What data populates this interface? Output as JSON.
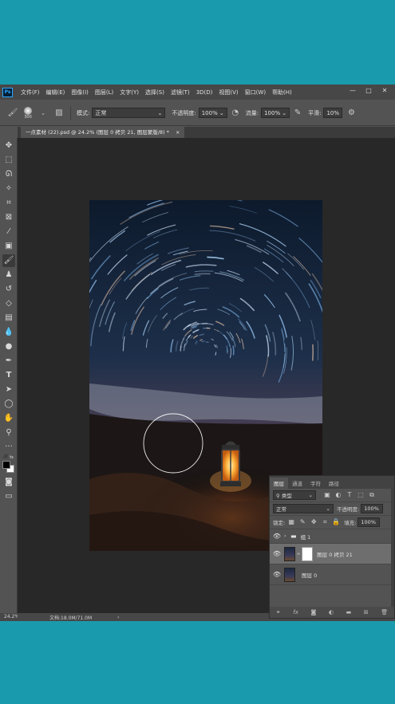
{
  "menubar": {
    "logo": "Ps",
    "items": [
      "文件(F)",
      "编辑(E)",
      "图像(I)",
      "图层(L)",
      "文字(Y)",
      "选择(S)",
      "滤镜(T)",
      "3D(D)",
      "视图(V)",
      "窗口(W)",
      "帮助(H)"
    ],
    "window_controls": [
      "—",
      "□",
      "✕"
    ]
  },
  "options": {
    "brush_size": "300",
    "mode_label": "模式:",
    "mode_value": "正常",
    "opacity_label": "不透明度:",
    "opacity_value": "100%",
    "flow_label": "流量:",
    "flow_value": "100%",
    "smoothing_label": "平滑:",
    "smoothing_value": "10%"
  },
  "document_tab": {
    "title": "一点素材 (22).psd @ 24.2% (图层 0 拷贝 21, 图层蒙版/8) *",
    "close": "×"
  },
  "toolbar": {
    "tools": [
      "move-tool",
      "marquee-tool",
      "lasso-tool",
      "magic-wand-tool",
      "crop-tool",
      "frame-tool",
      "eyedropper-tool",
      "healing-brush-tool",
      "brush-tool",
      "clone-stamp-tool",
      "history-brush-tool",
      "eraser-tool",
      "gradient-tool",
      "blur-tool",
      "dodge-tool",
      "pen-tool",
      "type-tool",
      "path-selection-tool",
      "shape-tool",
      "hand-tool",
      "zoom-tool",
      "more-tools"
    ],
    "active_tool": "brush-tool",
    "foreground_color": "#000000",
    "background_color": "#ffffff"
  },
  "status": {
    "zoom": "24.2%",
    "doc_info": "文档:18.0M/71.0M",
    "arrow": "›"
  },
  "layers_panel": {
    "tabs": [
      "图层",
      "通道",
      "字符",
      "路径"
    ],
    "active_tab": "图层",
    "filter_label": "类型",
    "blend_mode": "正常",
    "opacity_label": "不透明度:",
    "opacity_value": "100%",
    "lock_label": "锁定:",
    "fill_label": "填充:",
    "fill_value": "100%",
    "layers": [
      {
        "name": "组 1",
        "type": "group",
        "selected": false
      },
      {
        "name": "图层 0 拷贝 21",
        "type": "layer-with-mask",
        "selected": true
      },
      {
        "name": "图层 0",
        "type": "layer",
        "selected": false
      }
    ],
    "footer_icons": [
      "link-icon",
      "fx-icon",
      "mask-icon",
      "adjustment-icon",
      "folder-icon",
      "new-layer-icon",
      "trash-icon"
    ]
  }
}
